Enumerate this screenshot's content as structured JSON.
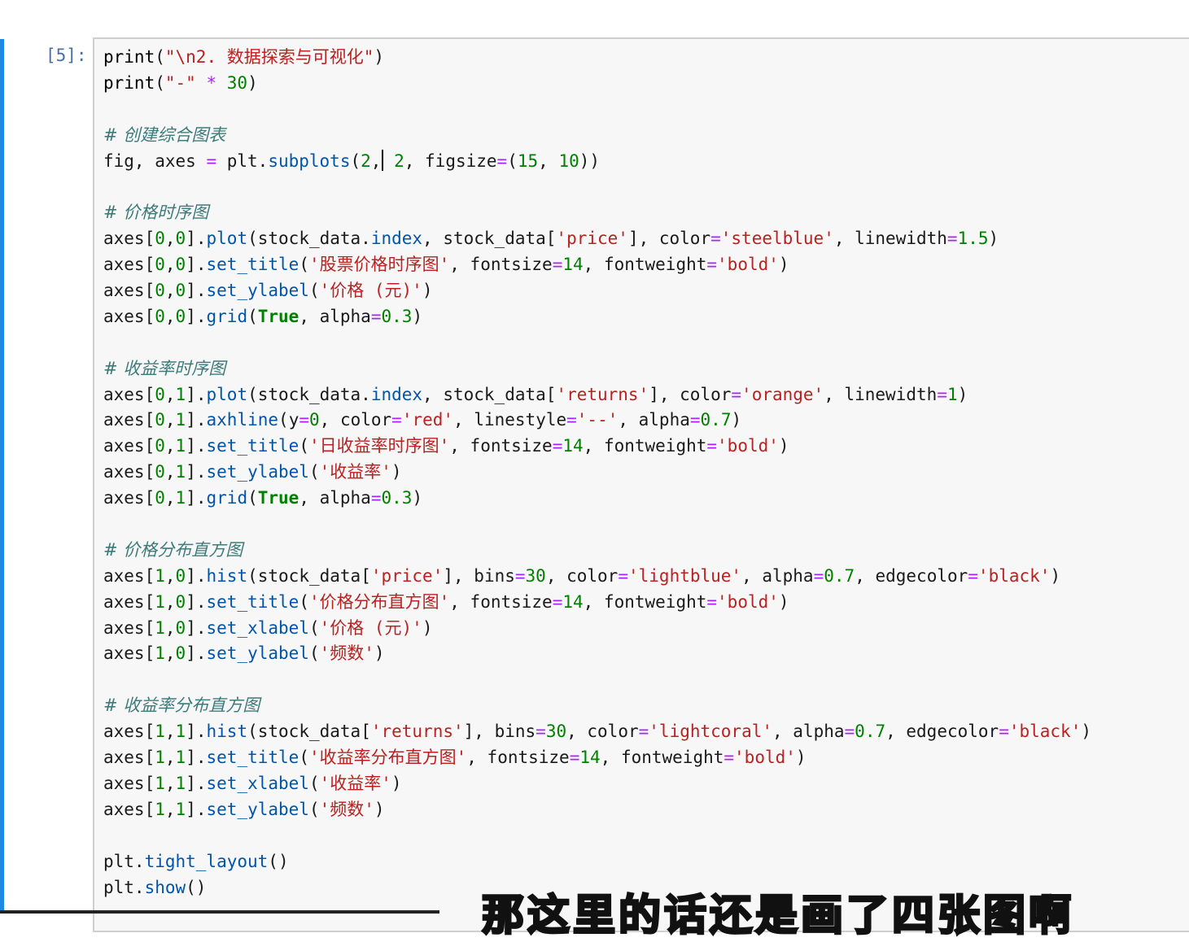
{
  "cell": {
    "prompt": "[5]:",
    "lines": [
      [
        [
          "t-kw-fn",
          "print"
        ],
        [
          "t-brk",
          "("
        ],
        [
          "t-str",
          "\"\\n2. 数据探索与可视化\""
        ],
        [
          "t-brk",
          ")"
        ]
      ],
      [
        [
          "t-kw-fn",
          "print"
        ],
        [
          "t-brk",
          "("
        ],
        [
          "t-str",
          "\"-\""
        ],
        [
          "t-plain",
          " "
        ],
        [
          "t-op",
          "*"
        ],
        [
          "t-plain",
          " "
        ],
        [
          "t-num",
          "30"
        ],
        [
          "t-brk",
          ")"
        ]
      ],
      [],
      [
        [
          "t-com",
          "# 创建综合图表"
        ]
      ],
      [
        [
          "t-plain",
          "fig, axes "
        ],
        [
          "t-op",
          "="
        ],
        [
          "t-plain",
          " plt."
        ],
        [
          "t-attr",
          "subplots"
        ],
        [
          "t-brk",
          "("
        ],
        [
          "t-num",
          "2"
        ],
        [
          "t-plain",
          ","
        ],
        [
          "cursor",
          ""
        ],
        [
          "t-plain",
          " "
        ],
        [
          "t-num",
          "2"
        ],
        [
          "t-plain",
          ", figsize"
        ],
        [
          "t-op",
          "="
        ],
        [
          "t-brk",
          "("
        ],
        [
          "t-num",
          "15"
        ],
        [
          "t-plain",
          ", "
        ],
        [
          "t-num",
          "10"
        ],
        [
          "t-brk",
          "))"
        ]
      ],
      [],
      [
        [
          "t-com",
          "# 价格时序图"
        ]
      ],
      [
        [
          "t-plain",
          "axes"
        ],
        [
          "t-brk",
          "["
        ],
        [
          "t-num",
          "0"
        ],
        [
          "t-plain",
          ","
        ],
        [
          "t-num",
          "0"
        ],
        [
          "t-brk",
          "]"
        ],
        [
          "t-plain",
          "."
        ],
        [
          "t-attr",
          "plot"
        ],
        [
          "t-brk",
          "("
        ],
        [
          "t-plain",
          "stock_data."
        ],
        [
          "t-attr",
          "index"
        ],
        [
          "t-plain",
          ", stock_data"
        ],
        [
          "t-brk",
          "["
        ],
        [
          "t-str",
          "'price'"
        ],
        [
          "t-brk",
          "]"
        ],
        [
          "t-plain",
          ", color"
        ],
        [
          "t-op",
          "="
        ],
        [
          "t-str",
          "'steelblue'"
        ],
        [
          "t-plain",
          ", linewidth"
        ],
        [
          "t-op",
          "="
        ],
        [
          "t-num",
          "1.5"
        ],
        [
          "t-brk",
          ")"
        ]
      ],
      [
        [
          "t-plain",
          "axes"
        ],
        [
          "t-brk",
          "["
        ],
        [
          "t-num",
          "0"
        ],
        [
          "t-plain",
          ","
        ],
        [
          "t-num",
          "0"
        ],
        [
          "t-brk",
          "]"
        ],
        [
          "t-plain",
          "."
        ],
        [
          "t-attr",
          "set_title"
        ],
        [
          "t-brk",
          "("
        ],
        [
          "t-str",
          "'股票价格时序图'"
        ],
        [
          "t-plain",
          ", fontsize"
        ],
        [
          "t-op",
          "="
        ],
        [
          "t-num",
          "14"
        ],
        [
          "t-plain",
          ", fontweight"
        ],
        [
          "t-op",
          "="
        ],
        [
          "t-str",
          "'bold'"
        ],
        [
          "t-brk",
          ")"
        ]
      ],
      [
        [
          "t-plain",
          "axes"
        ],
        [
          "t-brk",
          "["
        ],
        [
          "t-num",
          "0"
        ],
        [
          "t-plain",
          ","
        ],
        [
          "t-num",
          "0"
        ],
        [
          "t-brk",
          "]"
        ],
        [
          "t-plain",
          "."
        ],
        [
          "t-attr",
          "set_ylabel"
        ],
        [
          "t-brk",
          "("
        ],
        [
          "t-str",
          "'价格 (元)'"
        ],
        [
          "t-brk",
          ")"
        ]
      ],
      [
        [
          "t-plain",
          "axes"
        ],
        [
          "t-brk",
          "["
        ],
        [
          "t-num",
          "0"
        ],
        [
          "t-plain",
          ","
        ],
        [
          "t-num",
          "0"
        ],
        [
          "t-brk",
          "]"
        ],
        [
          "t-plain",
          "."
        ],
        [
          "t-attr",
          "grid"
        ],
        [
          "t-brk",
          "("
        ],
        [
          "t-bool",
          "True"
        ],
        [
          "t-plain",
          ", alpha"
        ],
        [
          "t-op",
          "="
        ],
        [
          "t-num",
          "0.3"
        ],
        [
          "t-brk",
          ")"
        ]
      ],
      [],
      [
        [
          "t-com",
          "# 收益率时序图"
        ]
      ],
      [
        [
          "t-plain",
          "axes"
        ],
        [
          "t-brk",
          "["
        ],
        [
          "t-num",
          "0"
        ],
        [
          "t-plain",
          ","
        ],
        [
          "t-num",
          "1"
        ],
        [
          "t-brk",
          "]"
        ],
        [
          "t-plain",
          "."
        ],
        [
          "t-attr",
          "plot"
        ],
        [
          "t-brk",
          "("
        ],
        [
          "t-plain",
          "stock_data."
        ],
        [
          "t-attr",
          "index"
        ],
        [
          "t-plain",
          ", stock_data"
        ],
        [
          "t-brk",
          "["
        ],
        [
          "t-str",
          "'returns'"
        ],
        [
          "t-brk",
          "]"
        ],
        [
          "t-plain",
          ", color"
        ],
        [
          "t-op",
          "="
        ],
        [
          "t-str",
          "'orange'"
        ],
        [
          "t-plain",
          ", linewidth"
        ],
        [
          "t-op",
          "="
        ],
        [
          "t-num",
          "1"
        ],
        [
          "t-brk",
          ")"
        ]
      ],
      [
        [
          "t-plain",
          "axes"
        ],
        [
          "t-brk",
          "["
        ],
        [
          "t-num",
          "0"
        ],
        [
          "t-plain",
          ","
        ],
        [
          "t-num",
          "1"
        ],
        [
          "t-brk",
          "]"
        ],
        [
          "t-plain",
          "."
        ],
        [
          "t-attr",
          "axhline"
        ],
        [
          "t-brk",
          "("
        ],
        [
          "t-plain",
          "y"
        ],
        [
          "t-op",
          "="
        ],
        [
          "t-num",
          "0"
        ],
        [
          "t-plain",
          ", color"
        ],
        [
          "t-op",
          "="
        ],
        [
          "t-str",
          "'red'"
        ],
        [
          "t-plain",
          ", linestyle"
        ],
        [
          "t-op",
          "="
        ],
        [
          "t-str",
          "'--'"
        ],
        [
          "t-plain",
          ", alpha"
        ],
        [
          "t-op",
          "="
        ],
        [
          "t-num",
          "0.7"
        ],
        [
          "t-brk",
          ")"
        ]
      ],
      [
        [
          "t-plain",
          "axes"
        ],
        [
          "t-brk",
          "["
        ],
        [
          "t-num",
          "0"
        ],
        [
          "t-plain",
          ","
        ],
        [
          "t-num",
          "1"
        ],
        [
          "t-brk",
          "]"
        ],
        [
          "t-plain",
          "."
        ],
        [
          "t-attr",
          "set_title"
        ],
        [
          "t-brk",
          "("
        ],
        [
          "t-str",
          "'日收益率时序图'"
        ],
        [
          "t-plain",
          ", fontsize"
        ],
        [
          "t-op",
          "="
        ],
        [
          "t-num",
          "14"
        ],
        [
          "t-plain",
          ", fontweight"
        ],
        [
          "t-op",
          "="
        ],
        [
          "t-str",
          "'bold'"
        ],
        [
          "t-brk",
          ")"
        ]
      ],
      [
        [
          "t-plain",
          "axes"
        ],
        [
          "t-brk",
          "["
        ],
        [
          "t-num",
          "0"
        ],
        [
          "t-plain",
          ","
        ],
        [
          "t-num",
          "1"
        ],
        [
          "t-brk",
          "]"
        ],
        [
          "t-plain",
          "."
        ],
        [
          "t-attr",
          "set_ylabel"
        ],
        [
          "t-brk",
          "("
        ],
        [
          "t-str",
          "'收益率'"
        ],
        [
          "t-brk",
          ")"
        ]
      ],
      [
        [
          "t-plain",
          "axes"
        ],
        [
          "t-brk",
          "["
        ],
        [
          "t-num",
          "0"
        ],
        [
          "t-plain",
          ","
        ],
        [
          "t-num",
          "1"
        ],
        [
          "t-brk",
          "]"
        ],
        [
          "t-plain",
          "."
        ],
        [
          "t-attr",
          "grid"
        ],
        [
          "t-brk",
          "("
        ],
        [
          "t-bool",
          "True"
        ],
        [
          "t-plain",
          ", alpha"
        ],
        [
          "t-op",
          "="
        ],
        [
          "t-num",
          "0.3"
        ],
        [
          "t-brk",
          ")"
        ]
      ],
      [],
      [
        [
          "t-com",
          "# 价格分布直方图"
        ]
      ],
      [
        [
          "t-plain",
          "axes"
        ],
        [
          "t-brk",
          "["
        ],
        [
          "t-num",
          "1"
        ],
        [
          "t-plain",
          ","
        ],
        [
          "t-num",
          "0"
        ],
        [
          "t-brk",
          "]"
        ],
        [
          "t-plain",
          "."
        ],
        [
          "t-attr",
          "hist"
        ],
        [
          "t-brk",
          "("
        ],
        [
          "t-plain",
          "stock_data"
        ],
        [
          "t-brk",
          "["
        ],
        [
          "t-str",
          "'price'"
        ],
        [
          "t-brk",
          "]"
        ],
        [
          "t-plain",
          ", bins"
        ],
        [
          "t-op",
          "="
        ],
        [
          "t-num",
          "30"
        ],
        [
          "t-plain",
          ", color"
        ],
        [
          "t-op",
          "="
        ],
        [
          "t-str",
          "'lightblue'"
        ],
        [
          "t-plain",
          ", alpha"
        ],
        [
          "t-op",
          "="
        ],
        [
          "t-num",
          "0.7"
        ],
        [
          "t-plain",
          ", edgecolor"
        ],
        [
          "t-op",
          "="
        ],
        [
          "t-str",
          "'black'"
        ],
        [
          "t-brk",
          ")"
        ]
      ],
      [
        [
          "t-plain",
          "axes"
        ],
        [
          "t-brk",
          "["
        ],
        [
          "t-num",
          "1"
        ],
        [
          "t-plain",
          ","
        ],
        [
          "t-num",
          "0"
        ],
        [
          "t-brk",
          "]"
        ],
        [
          "t-plain",
          "."
        ],
        [
          "t-attr",
          "set_title"
        ],
        [
          "t-brk",
          "("
        ],
        [
          "t-str",
          "'价格分布直方图'"
        ],
        [
          "t-plain",
          ", fontsize"
        ],
        [
          "t-op",
          "="
        ],
        [
          "t-num",
          "14"
        ],
        [
          "t-plain",
          ", fontweight"
        ],
        [
          "t-op",
          "="
        ],
        [
          "t-str",
          "'bold'"
        ],
        [
          "t-brk",
          ")"
        ]
      ],
      [
        [
          "t-plain",
          "axes"
        ],
        [
          "t-brk",
          "["
        ],
        [
          "t-num",
          "1"
        ],
        [
          "t-plain",
          ","
        ],
        [
          "t-num",
          "0"
        ],
        [
          "t-brk",
          "]"
        ],
        [
          "t-plain",
          "."
        ],
        [
          "t-attr",
          "set_xlabel"
        ],
        [
          "t-brk",
          "("
        ],
        [
          "t-str",
          "'价格 (元)'"
        ],
        [
          "t-brk",
          ")"
        ]
      ],
      [
        [
          "t-plain",
          "axes"
        ],
        [
          "t-brk",
          "["
        ],
        [
          "t-num",
          "1"
        ],
        [
          "t-plain",
          ","
        ],
        [
          "t-num",
          "0"
        ],
        [
          "t-brk",
          "]"
        ],
        [
          "t-plain",
          "."
        ],
        [
          "t-attr",
          "set_ylabel"
        ],
        [
          "t-brk",
          "("
        ],
        [
          "t-str",
          "'频数'"
        ],
        [
          "t-brk",
          ")"
        ]
      ],
      [],
      [
        [
          "t-com",
          "# 收益率分布直方图"
        ]
      ],
      [
        [
          "t-plain",
          "axes"
        ],
        [
          "t-brk",
          "["
        ],
        [
          "t-num",
          "1"
        ],
        [
          "t-plain",
          ","
        ],
        [
          "t-num",
          "1"
        ],
        [
          "t-brk",
          "]"
        ],
        [
          "t-plain",
          "."
        ],
        [
          "t-attr",
          "hist"
        ],
        [
          "t-brk",
          "("
        ],
        [
          "t-plain",
          "stock_data"
        ],
        [
          "t-brk",
          "["
        ],
        [
          "t-str",
          "'returns'"
        ],
        [
          "t-brk",
          "]"
        ],
        [
          "t-plain",
          ", bins"
        ],
        [
          "t-op",
          "="
        ],
        [
          "t-num",
          "30"
        ],
        [
          "t-plain",
          ", color"
        ],
        [
          "t-op",
          "="
        ],
        [
          "t-str",
          "'lightcoral'"
        ],
        [
          "t-plain",
          ", alpha"
        ],
        [
          "t-op",
          "="
        ],
        [
          "t-num",
          "0.7"
        ],
        [
          "t-plain",
          ", edgecolor"
        ],
        [
          "t-op",
          "="
        ],
        [
          "t-str",
          "'black'"
        ],
        [
          "t-brk",
          ")"
        ]
      ],
      [
        [
          "t-plain",
          "axes"
        ],
        [
          "t-brk",
          "["
        ],
        [
          "t-num",
          "1"
        ],
        [
          "t-plain",
          ","
        ],
        [
          "t-num",
          "1"
        ],
        [
          "t-brk",
          "]"
        ],
        [
          "t-plain",
          "."
        ],
        [
          "t-attr",
          "set_title"
        ],
        [
          "t-brk",
          "("
        ],
        [
          "t-str",
          "'收益率分布直方图'"
        ],
        [
          "t-plain",
          ", fontsize"
        ],
        [
          "t-op",
          "="
        ],
        [
          "t-num",
          "14"
        ],
        [
          "t-plain",
          ", fontweight"
        ],
        [
          "t-op",
          "="
        ],
        [
          "t-str",
          "'bold'"
        ],
        [
          "t-brk",
          ")"
        ]
      ],
      [
        [
          "t-plain",
          "axes"
        ],
        [
          "t-brk",
          "["
        ],
        [
          "t-num",
          "1"
        ],
        [
          "t-plain",
          ","
        ],
        [
          "t-num",
          "1"
        ],
        [
          "t-brk",
          "]"
        ],
        [
          "t-plain",
          "."
        ],
        [
          "t-attr",
          "set_xlabel"
        ],
        [
          "t-brk",
          "("
        ],
        [
          "t-str",
          "'收益率'"
        ],
        [
          "t-brk",
          ")"
        ]
      ],
      [
        [
          "t-plain",
          "axes"
        ],
        [
          "t-brk",
          "["
        ],
        [
          "t-num",
          "1"
        ],
        [
          "t-plain",
          ","
        ],
        [
          "t-num",
          "1"
        ],
        [
          "t-brk",
          "]"
        ],
        [
          "t-plain",
          "."
        ],
        [
          "t-attr",
          "set_ylabel"
        ],
        [
          "t-brk",
          "("
        ],
        [
          "t-str",
          "'频数'"
        ],
        [
          "t-brk",
          ")"
        ]
      ],
      [],
      [
        [
          "t-plain",
          "plt."
        ],
        [
          "t-attr",
          "tight_layout"
        ],
        [
          "t-brk",
          "()"
        ]
      ],
      [
        [
          "t-plain",
          "plt."
        ],
        [
          "t-attr",
          "show"
        ],
        [
          "t-brk",
          "()"
        ]
      ]
    ]
  },
  "subtitle": "那这里的话还是画了四张图啊",
  "colors": {
    "active_cell_bar": "#1e88e5",
    "prompt": "#4a6fa5",
    "editor_bg": "#f7f7f7",
    "string": "#ba2121",
    "number": "#008000",
    "operator": "#aa22ff",
    "attribute": "#0055aa",
    "comment": "#3d7b7b"
  }
}
